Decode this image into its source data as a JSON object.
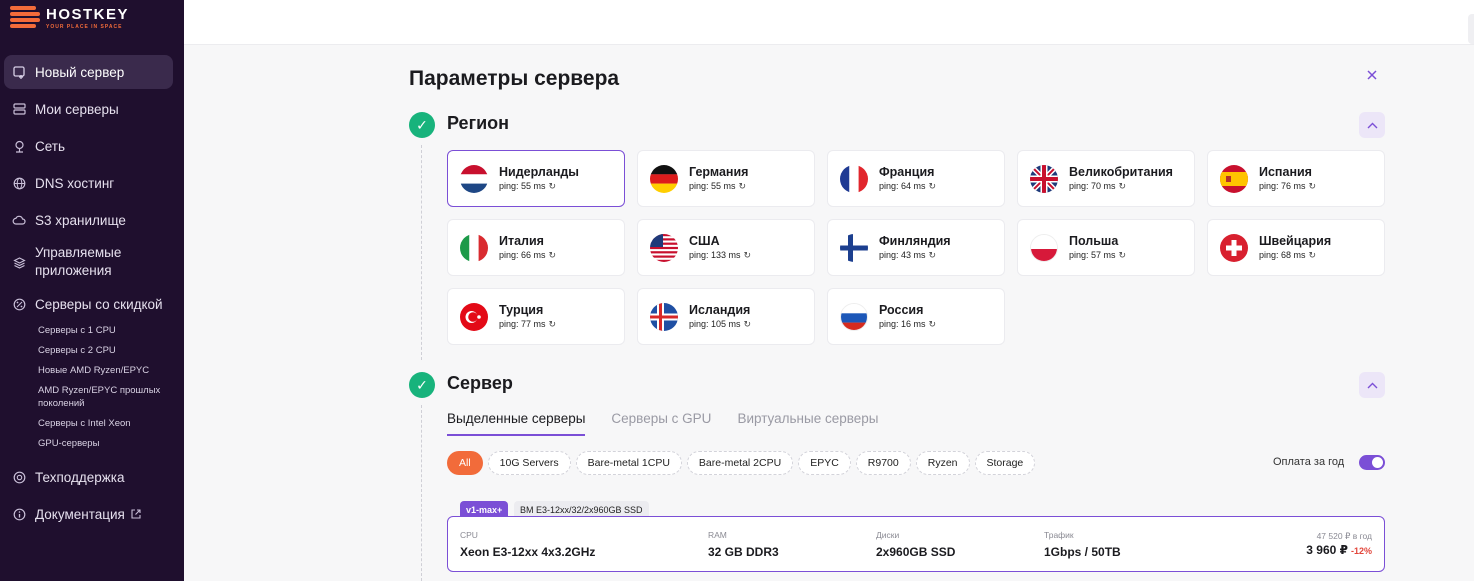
{
  "brand": {
    "name": "HOSTKEY",
    "tagline": "YOUR PLACE IN SPACE",
    "accent": "#f26b3a",
    "primary": "#7b4fd6",
    "success": "#18b37c"
  },
  "sidebar": {
    "items": [
      {
        "label": "Новый сервер",
        "icon": "new-server-icon"
      },
      {
        "label": "Мои серверы",
        "icon": "servers-icon"
      },
      {
        "label": "Сеть",
        "icon": "network-icon"
      },
      {
        "label": "DNS хостинг",
        "icon": "globe-icon"
      },
      {
        "label": "S3 хранилище",
        "icon": "cloud-icon"
      },
      {
        "label": "Управляемые приложения",
        "icon": "layers-icon"
      },
      {
        "label": "Серверы со скидкой",
        "icon": "discount-icon"
      }
    ],
    "subitems": [
      "Серверы с 1 CPU",
      "Серверы с 2 CPU",
      "Новые AMD Ryzen/EPYC",
      "AMD Ryzen/EPYC прошлых поколений",
      "Серверы с Intel Xeon",
      "GPU-серверы"
    ],
    "bottom": [
      {
        "label": "Техподдержка",
        "icon": "support-icon"
      },
      {
        "label": "Документация",
        "icon": "info-icon"
      }
    ]
  },
  "page": {
    "title": "Параметры сервера",
    "close": "×"
  },
  "region": {
    "title": "Регион",
    "countries": [
      {
        "name": "Нидерланды",
        "ping": "ping: 55 ms",
        "flag": "nl",
        "selected": true
      },
      {
        "name": "Германия",
        "ping": "ping: 55 ms",
        "flag": "de"
      },
      {
        "name": "Франция",
        "ping": "ping: 64 ms",
        "flag": "fr"
      },
      {
        "name": "Великобритания",
        "ping": "ping: 70 ms",
        "flag": "gb"
      },
      {
        "name": "Испания",
        "ping": "ping: 76 ms",
        "flag": "es"
      },
      {
        "name": "Италия",
        "ping": "ping: 66 ms",
        "flag": "it"
      },
      {
        "name": "США",
        "ping": "ping: 133 ms",
        "flag": "us"
      },
      {
        "name": "Финляндия",
        "ping": "ping: 43 ms",
        "flag": "fi"
      },
      {
        "name": "Польша",
        "ping": "ping: 57 ms",
        "flag": "pl"
      },
      {
        "name": "Швейцария",
        "ping": "ping: 68 ms",
        "flag": "ch"
      },
      {
        "name": "Турция",
        "ping": "ping: 77 ms",
        "flag": "tr"
      },
      {
        "name": "Исландия",
        "ping": "ping: 105 ms",
        "flag": "is"
      },
      {
        "name": "Россия",
        "ping": "ping: 16 ms",
        "flag": "ru"
      }
    ]
  },
  "server": {
    "title": "Сервер",
    "tabs": [
      "Выделенные серверы",
      "Серверы с GPU",
      "Виртуальные серверы"
    ],
    "filters": [
      "All",
      "10G Servers",
      "Bare-metal 1CPU",
      "Bare-metal 2CPU",
      "EPYC",
      "R9700",
      "Ryzen",
      "Storage"
    ],
    "yearly_label": "Оплата за год",
    "yearly_on": true,
    "offer": {
      "badge": "v1-max+",
      "model": "BM E3-12xx/32/2x960GB SSD",
      "cpu_label": "CPU",
      "cpu": "Xeon E3-12xx 4x3.2GHz",
      "ram_label": "RAM",
      "ram": "32 GB DDR3",
      "disk_label": "Диски",
      "disk": "2x960GB SSD",
      "traffic_label": "Трафик",
      "traffic": "1Gbps / 50TB",
      "old_price": "47 520 ₽ в год",
      "price": "3 960 ₽",
      "discount": "-12%"
    }
  }
}
